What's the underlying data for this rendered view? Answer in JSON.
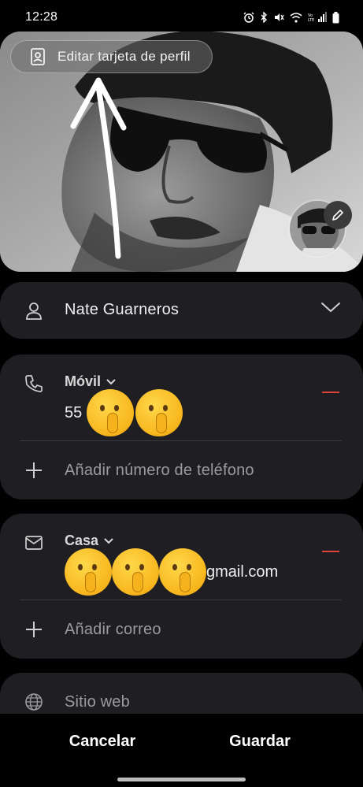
{
  "status_bar": {
    "time": "12:28",
    "network_label": "Vo LTE"
  },
  "profile": {
    "edit_card_label": "Editar tarjeta de perfil"
  },
  "name_card": {
    "name": "Nate Guarneros"
  },
  "phone_card": {
    "type_label": "Móvil",
    "value_prefix": "55",
    "add_label": "Añadir número de teléfono"
  },
  "email_card": {
    "type_label": "Casa",
    "value_suffix": "gmail.com",
    "add_label": "Añadir correo"
  },
  "web_card": {
    "label": "Sitio web"
  },
  "footer": {
    "cancel_label": "Cancelar",
    "save_label": "Guardar"
  },
  "colors": {
    "card_bg": "#1f1f23",
    "remove_red": "#e0433b",
    "muted_text": "#9b9b9f"
  },
  "icons": [
    "alarm-icon",
    "bluetooth-icon",
    "mute-icon",
    "wifi-icon",
    "signal-icon",
    "battery-icon",
    "profile-card-icon",
    "pencil-icon",
    "person-icon",
    "chevron-down-icon",
    "phone-icon",
    "mail-icon",
    "plus-icon",
    "globe-icon",
    "shush-emoji"
  ]
}
